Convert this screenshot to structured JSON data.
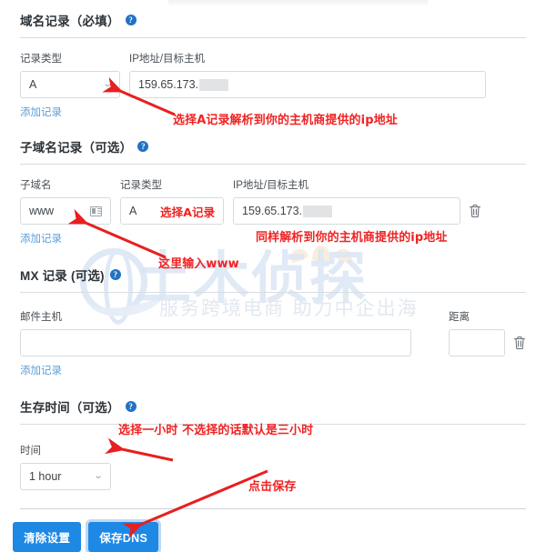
{
  "sections": {
    "domain_records": {
      "title": "域名记录（必填）",
      "help_icon": "help-icon",
      "labels": {
        "record_type": "记录类型",
        "ip_host": "IP地址/目标主机"
      },
      "record_type_value": "A",
      "ip_value": "159.65.173.",
      "add_link": "添加记录"
    },
    "subdomain_records": {
      "title": "子域名记录（可选）",
      "help_icon": "help-icon",
      "labels": {
        "subdomain": "子域名",
        "record_type": "记录类型",
        "ip_host": "IP地址/目标主机"
      },
      "subdomain_value": "www",
      "subdomain_icon": "contact-card-icon",
      "record_type_value": "A",
      "ip_value": "159.65.173.",
      "delete_icon": "trash-icon",
      "add_link": "添加记录"
    },
    "mx_records": {
      "title": "MX 记录 (可选)",
      "help_icon": "help-icon",
      "labels": {
        "mail_host": "邮件主机",
        "distance": "距离"
      },
      "mail_host_value": "",
      "distance_value": "",
      "delete_icon": "trash-icon",
      "add_link": "添加记录"
    },
    "ttl": {
      "title": "生存时间（可选）",
      "help_icon": "help-icon",
      "labels": {
        "time": "时间"
      },
      "time_value": "1 hour"
    }
  },
  "buttons": {
    "clear": "清除设置",
    "save": "保存DNS"
  },
  "annotations": {
    "a1": "选择A记录解析到你的主机商提供的ip地址",
    "a2": "选择A记录",
    "a3": "同样解析到你的主机商提供的ip地址",
    "a4": "这里输入www",
    "a5": "选择一小时 不选择的话默认是三小时",
    "a6": "点击保存"
  },
  "watermark": {
    "brand": "土木侦探",
    "tagline": "服务跨境电商 助力中企出海"
  },
  "colors": {
    "accent_blue": "#1e88e5",
    "link_blue": "#5b9fdc",
    "annotation_red": "#f02222",
    "help_blue": "#2272c4"
  }
}
